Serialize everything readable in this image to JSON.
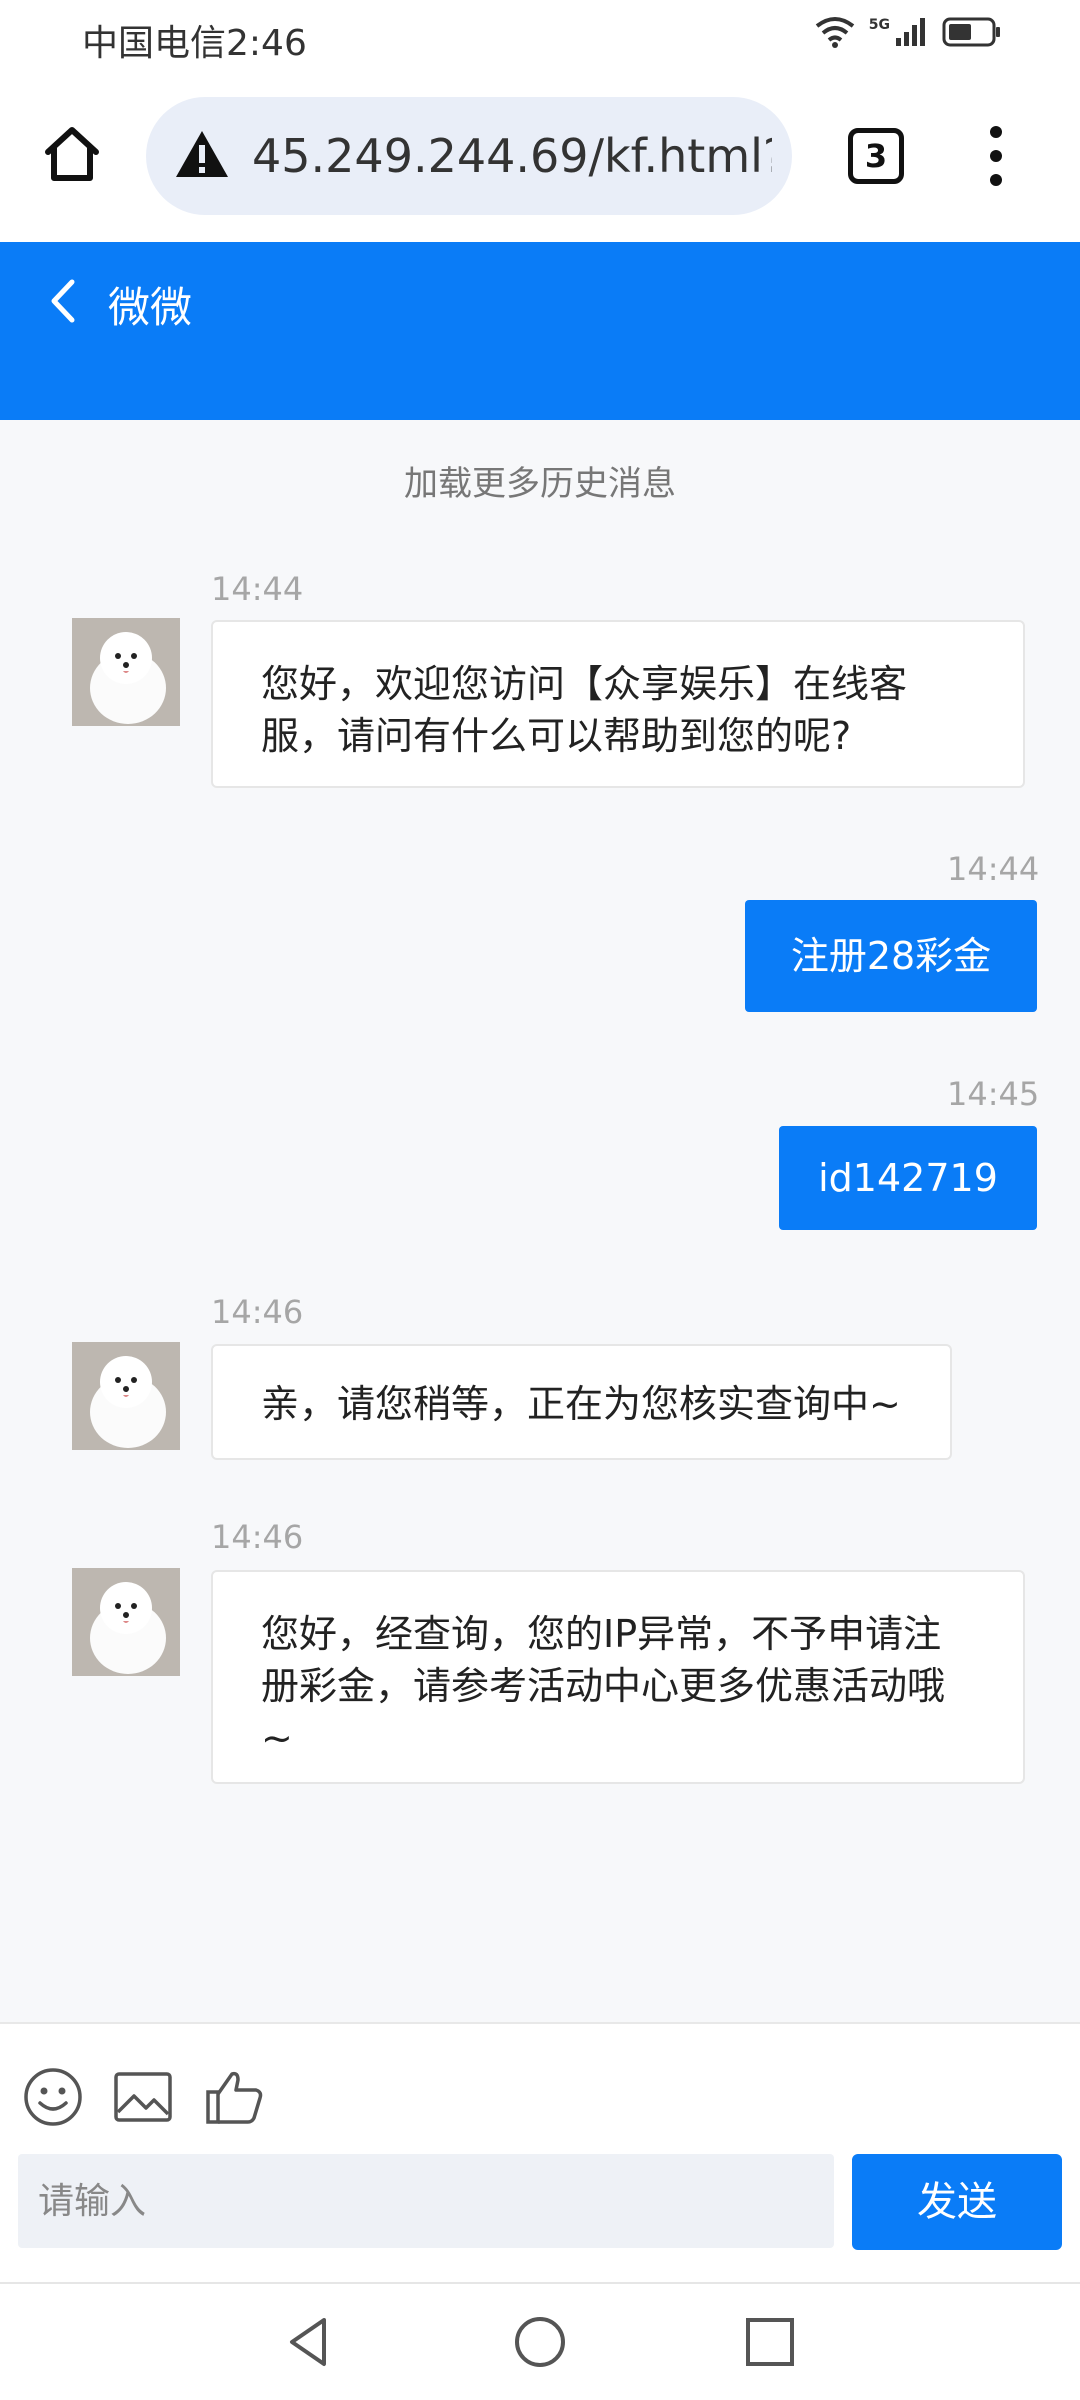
{
  "status_bar": {
    "carrier_time": "中国电信2:46",
    "network": "5G"
  },
  "browser": {
    "url": "45.249.244.69/kf.html?",
    "tab_count": "3"
  },
  "chat": {
    "title": "微微",
    "load_more": "加载更多历史消息"
  },
  "messages": [
    {
      "time": "14:44",
      "text": "您好，欢迎您访问【众享娱乐】在线客服，请问有什么可以帮助到您的呢?"
    },
    {
      "time": "14:44",
      "text": "注册28彩金"
    },
    {
      "time": "14:45",
      "text": "id142719"
    },
    {
      "time": "14:46",
      "text": "亲，请您稍等，正在为您核实查询中~"
    },
    {
      "time": "14:46",
      "text": "您好，经查询，您的IP异常，不予申请注册彩金，请参考活动中心更多优惠活动哦~"
    }
  ],
  "input": {
    "placeholder": "请输入",
    "send_label": "发送"
  },
  "colors": {
    "accent": "#0a7cf7",
    "chat_bg": "#f7f8fa"
  },
  "icons": [
    "home-icon",
    "warning-icon",
    "tabs-icon",
    "menu-icon",
    "back-icon",
    "emoji-icon",
    "image-icon",
    "thumbs-up-icon",
    "nav-back-icon",
    "nav-home-icon",
    "nav-recents-icon"
  ]
}
